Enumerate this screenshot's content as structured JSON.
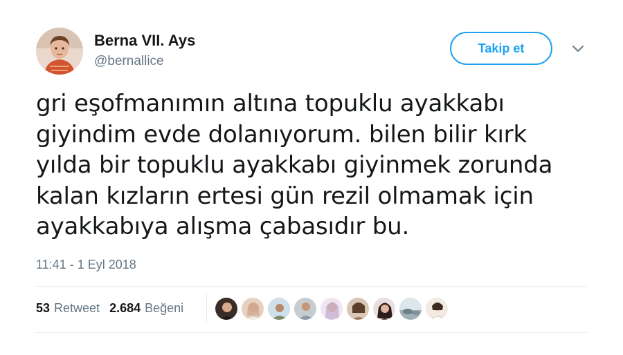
{
  "author": {
    "name": "Berna VII. Ays",
    "handle": "@bernallice",
    "avatar_icon": "profile-photo-child"
  },
  "follow_button": {
    "label": "Takip et",
    "color": "#1da1f2"
  },
  "menu_icon": "chevron-down-icon",
  "tweet": {
    "lines": [
      "gri eşofmanımın altına topuklu ayakkabı",
      "giyindim evde dolanıyorum. bilen bilir kırk",
      "yılda bir topuklu ayakkabı giyinmek zorunda",
      "kalan kızların ertesi gün rezil olmamak için",
      "ayakkabıya alışma çabasıdır bu."
    ],
    "timestamp": "11:41 - 1 Eyl 2018"
  },
  "stats": {
    "retweets_count": "53",
    "retweets_label": "Retweet",
    "likes_count": "2.684",
    "likes_label": "Beğeni"
  },
  "likers": [
    {
      "icon": "liker-avatar-1",
      "color": "#3a2d28"
    },
    {
      "icon": "liker-avatar-2",
      "color": "#c9a58b"
    },
    {
      "icon": "liker-avatar-3",
      "color": "#7d8b6a"
    },
    {
      "icon": "liker-avatar-4",
      "color": "#8a9aa8"
    },
    {
      "icon": "liker-avatar-5",
      "color": "#b9a0c4"
    },
    {
      "icon": "liker-avatar-6",
      "color": "#9b7b63"
    },
    {
      "icon": "liker-avatar-7",
      "color": "#5c3b3b"
    },
    {
      "icon": "liker-avatar-8",
      "color": "#b7c6cc"
    },
    {
      "icon": "liker-avatar-9",
      "color": "#d8c2a8"
    }
  ]
}
